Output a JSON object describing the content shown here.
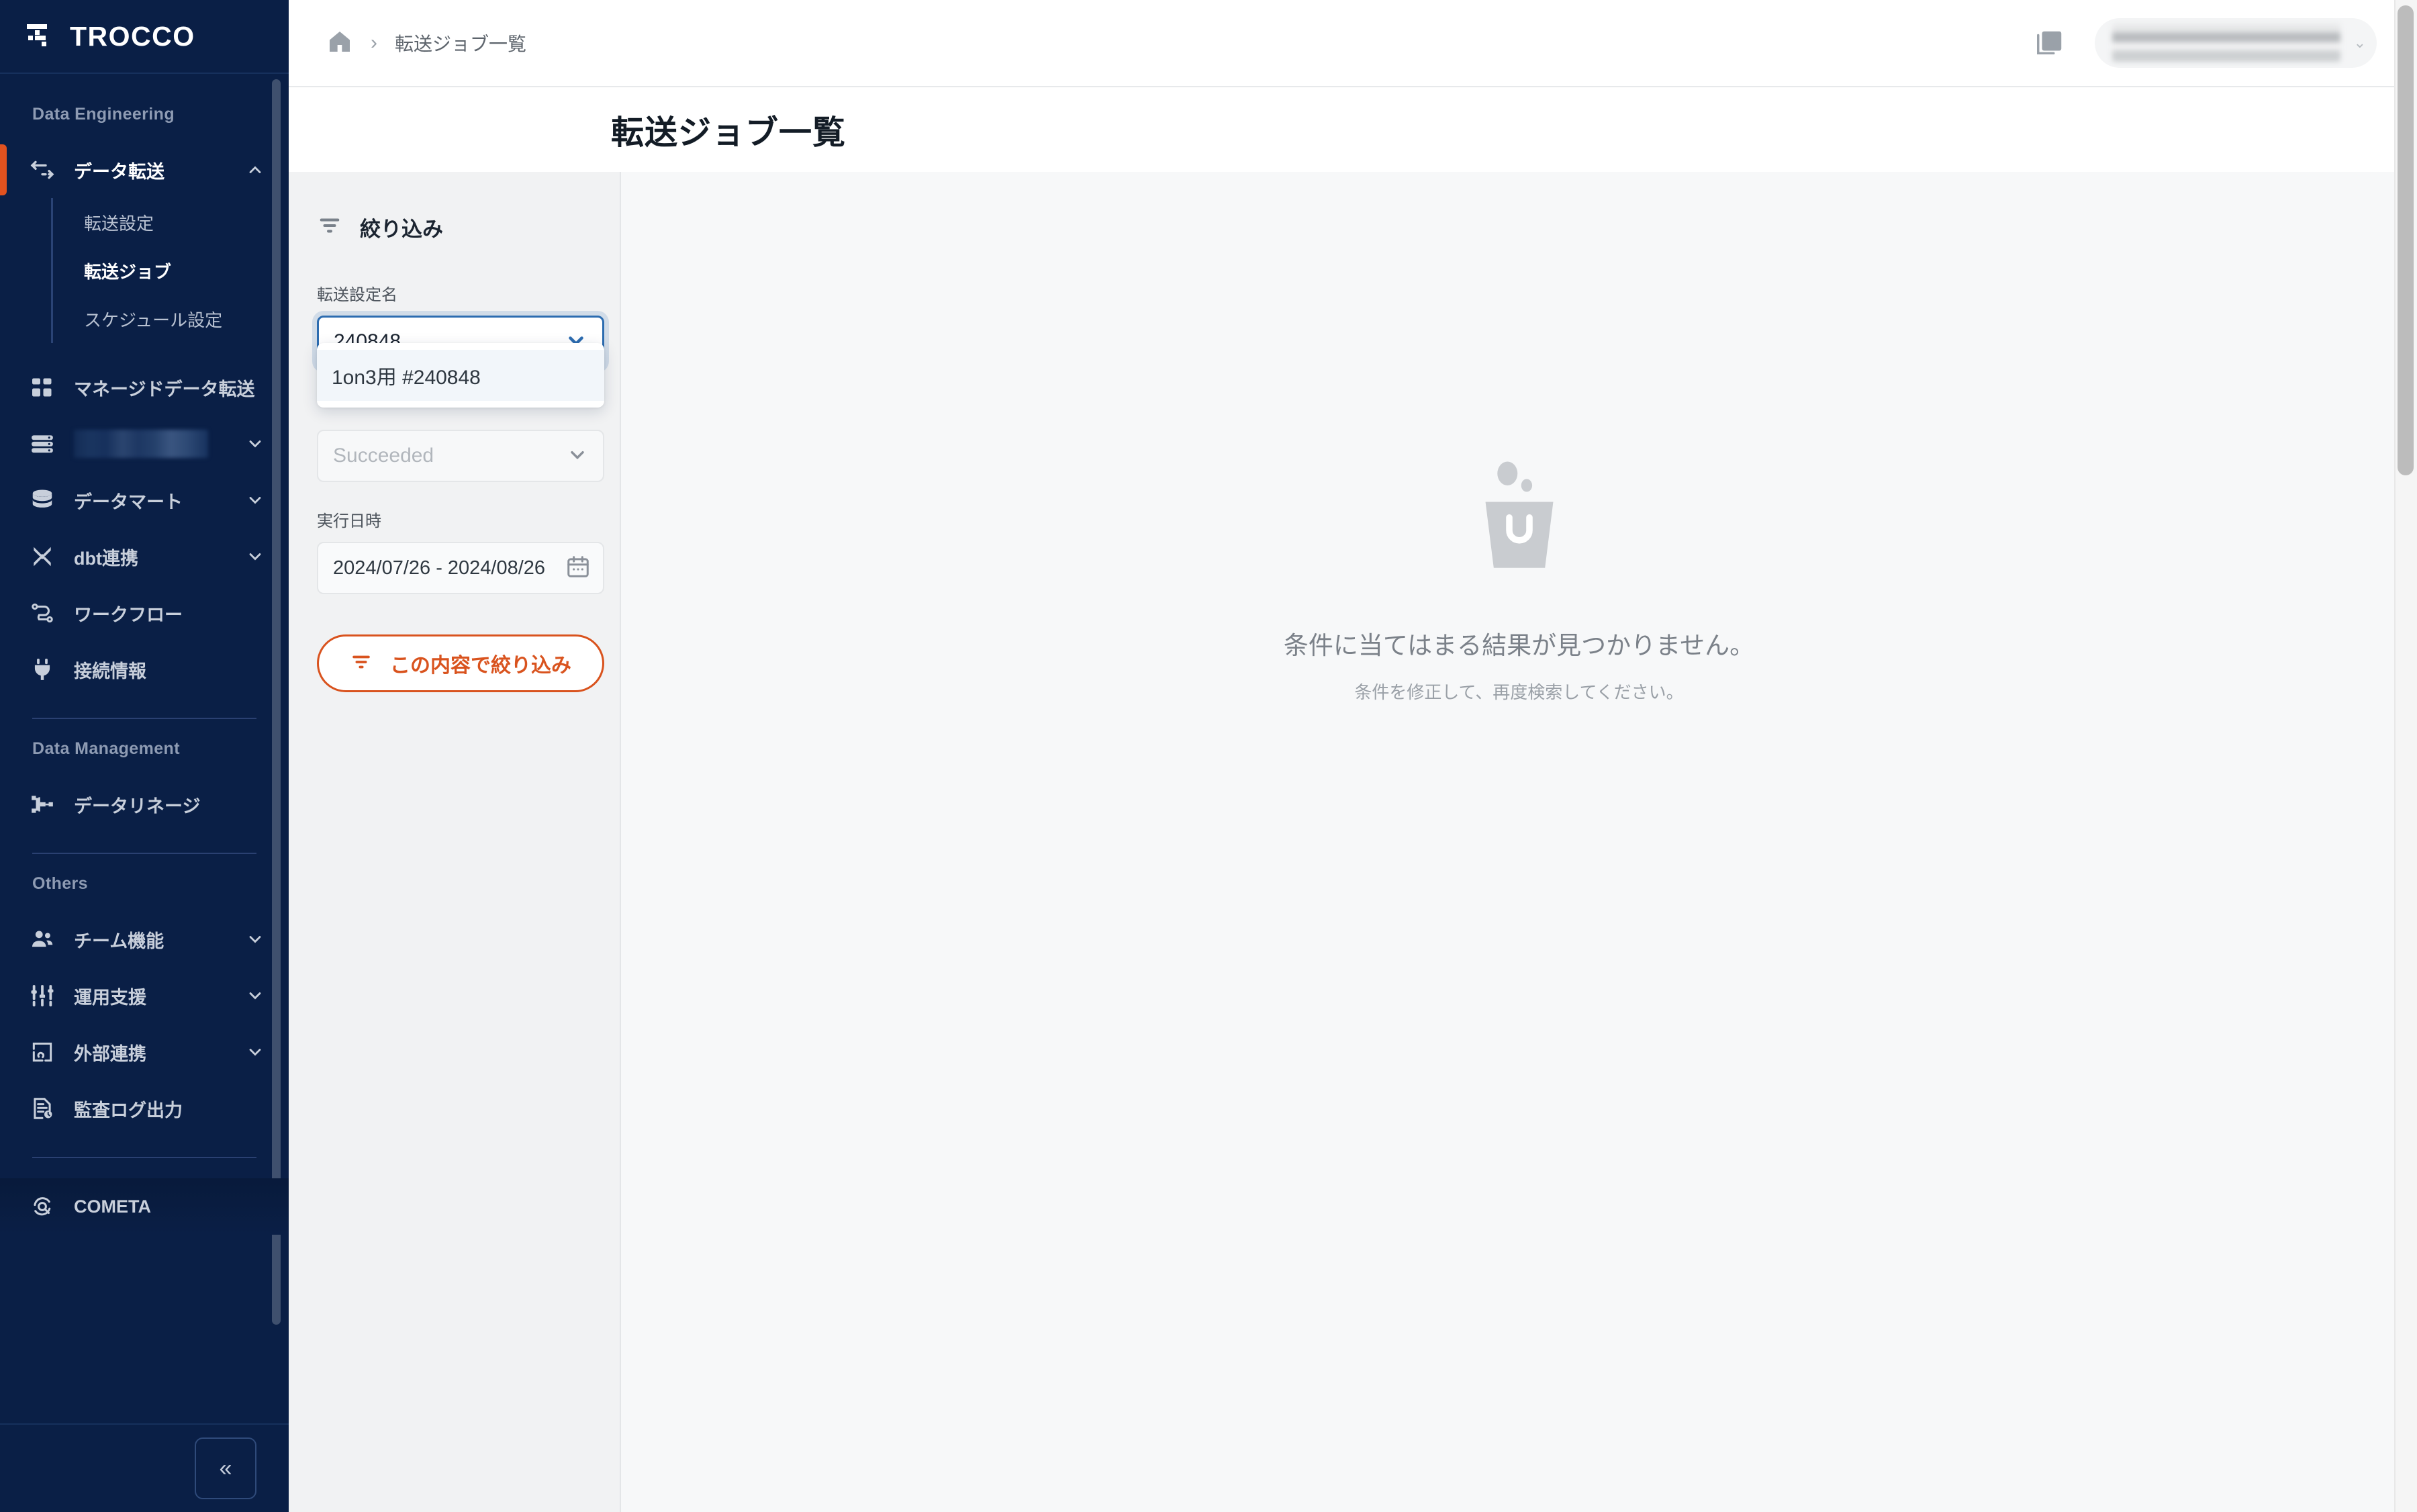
{
  "brand": {
    "name": "TROCCO",
    "logo_icon": "trocco-logo-icon",
    "accent": "#e2521f"
  },
  "sidebar": {
    "sections": [
      {
        "label": "Data Engineering",
        "items": [
          {
            "icon": "data-transfer-icon",
            "label": "データ転送",
            "expandable": true,
            "expanded": true,
            "active": true,
            "children": [
              {
                "label": "転送設定",
                "active": false
              },
              {
                "label": "転送ジョブ",
                "active": true
              },
              {
                "label": "スケジュール設定",
                "active": false
              }
            ]
          },
          {
            "icon": "managed-transfer-icon",
            "label": "マネージドデータ転送",
            "expandable": false,
            "active": false
          },
          {
            "icon": "server-stack-icon",
            "label": "",
            "redacted": true,
            "expandable": true,
            "active": false
          },
          {
            "icon": "database-icon",
            "label": "データマート",
            "expandable": true,
            "active": false
          },
          {
            "icon": "dbt-icon",
            "label": "dbt連携",
            "expandable": true,
            "active": false
          },
          {
            "icon": "workflow-icon",
            "label": "ワークフロー",
            "expandable": false,
            "active": false
          },
          {
            "icon": "plug-icon",
            "label": "接続情報",
            "expandable": false,
            "active": false
          }
        ]
      },
      {
        "label": "Data Management",
        "items": [
          {
            "icon": "lineage-icon",
            "label": "データリネージ",
            "expandable": false,
            "active": false
          }
        ]
      },
      {
        "label": "Others",
        "items": [
          {
            "icon": "team-icon",
            "label": "チーム機能",
            "expandable": true,
            "active": false
          },
          {
            "icon": "operation-support-icon",
            "label": "運用支援",
            "expandable": true,
            "active": false
          },
          {
            "icon": "external-link-icon",
            "label": "外部連携",
            "expandable": true,
            "active": false
          },
          {
            "icon": "audit-log-icon",
            "label": "監査ログ出力",
            "expandable": false,
            "active": false
          }
        ]
      }
    ],
    "cometa": {
      "icon": "cometa-icon",
      "label": "COMETA"
    },
    "collapse_button": {
      "icon": "chevron-double-left-icon",
      "label": "«"
    }
  },
  "topbar": {
    "breadcrumb": {
      "home_icon": "home-icon",
      "separator": "›",
      "current": "転送ジョブ一覧"
    },
    "help_icon": "help-document-icon",
    "user": {
      "redacted": true,
      "chevron_icon": "chevron-down-icon"
    }
  },
  "page": {
    "title": "転送ジョブ一覧"
  },
  "filter": {
    "heading": {
      "icon": "filter-icon",
      "label": "絞り込み"
    },
    "transfer_config": {
      "label": "転送設定名",
      "value": "240848",
      "focused": true,
      "chevron_icon": "chevron-down-icon",
      "dropdown_open": true,
      "options": [
        "1on3用 #240848"
      ]
    },
    "status": {
      "placeholder": "Succeeded",
      "value": "",
      "chevron_icon": "chevron-down-icon"
    },
    "execution_date": {
      "label": "実行日時",
      "value": "2024/07/26 - 2024/08/26",
      "calendar_icon": "calendar-icon"
    },
    "apply_button": {
      "icon": "filter-icon",
      "label": "この内容で絞り込み",
      "color": "#d9531e"
    }
  },
  "empty_state": {
    "icon": "empty-trash-icon",
    "title": "条件に当てはまる結果が見つかりません。",
    "subtitle": "条件を修正して、再度検索してください。"
  }
}
